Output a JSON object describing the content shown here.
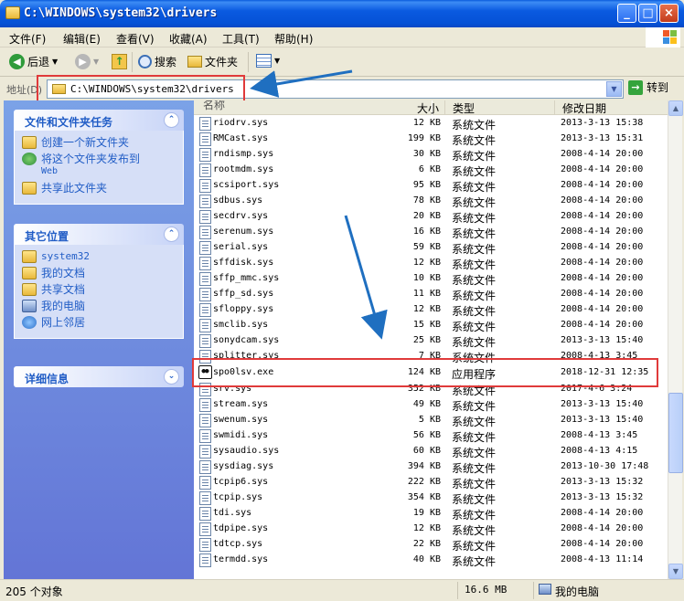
{
  "window": {
    "title": "C:\\WINDOWS\\system32\\drivers",
    "minimize": "_",
    "maximize": "□",
    "close": "×"
  },
  "menu": [
    "文件(F)",
    "编辑(E)",
    "查看(V)",
    "收藏(A)",
    "工具(T)",
    "帮助(H)"
  ],
  "toolbar": {
    "back": "后退",
    "search": "搜索",
    "folders": "文件夹"
  },
  "address": {
    "label": "地址(D)",
    "value": "C:\\WINDOWS\\system32\\drivers",
    "go": "转到"
  },
  "left_pane": {
    "tasks": {
      "title": "文件和文件夹任务",
      "items": [
        "创建一个新文件夹",
        "将这个文件夹发布到",
        "共享此文件夹"
      ],
      "sub": "Web"
    },
    "other_places": {
      "title": "其它位置",
      "items": [
        "system32",
        "我的文档",
        "共享文档",
        "我的电脑",
        "网上邻居"
      ]
    },
    "details": {
      "title": "详细信息"
    }
  },
  "columns": {
    "name": "名称",
    "size": "大小",
    "type": "类型",
    "date": "修改日期"
  },
  "files": [
    {
      "name": "riodrv.sys",
      "size": "12 KB",
      "type": "系统文件",
      "date": "2013-3-13 15:38"
    },
    {
      "name": "RMCast.sys",
      "size": "199 KB",
      "type": "系统文件",
      "date": "2013-3-13 15:31"
    },
    {
      "name": "rndismp.sys",
      "size": "30 KB",
      "type": "系统文件",
      "date": "2008-4-14 20:00"
    },
    {
      "name": "rootmdm.sys",
      "size": "6 KB",
      "type": "系统文件",
      "date": "2008-4-14 20:00"
    },
    {
      "name": "scsiport.sys",
      "size": "95 KB",
      "type": "系统文件",
      "date": "2008-4-14 20:00"
    },
    {
      "name": "sdbus.sys",
      "size": "78 KB",
      "type": "系统文件",
      "date": "2008-4-14 20:00"
    },
    {
      "name": "secdrv.sys",
      "size": "20 KB",
      "type": "系统文件",
      "date": "2008-4-14 20:00"
    },
    {
      "name": "serenum.sys",
      "size": "16 KB",
      "type": "系统文件",
      "date": "2008-4-14 20:00"
    },
    {
      "name": "serial.sys",
      "size": "59 KB",
      "type": "系统文件",
      "date": "2008-4-14 20:00"
    },
    {
      "name": "sffdisk.sys",
      "size": "12 KB",
      "type": "系统文件",
      "date": "2008-4-14 20:00"
    },
    {
      "name": "sffp_mmc.sys",
      "size": "10 KB",
      "type": "系统文件",
      "date": "2008-4-14 20:00"
    },
    {
      "name": "sffp_sd.sys",
      "size": "11 KB",
      "type": "系统文件",
      "date": "2008-4-14 20:00"
    },
    {
      "name": "sfloppy.sys",
      "size": "12 KB",
      "type": "系统文件",
      "date": "2008-4-14 20:00"
    },
    {
      "name": "smclib.sys",
      "size": "15 KB",
      "type": "系统文件",
      "date": "2008-4-14 20:00"
    },
    {
      "name": "sonydcam.sys",
      "size": "25 KB",
      "type": "系统文件",
      "date": "2013-3-13 15:40"
    },
    {
      "name": "splitter.sys",
      "size": "7 KB",
      "type": "系统文件",
      "date": "2008-4-13 3:45"
    },
    {
      "name": "spo0lsv.exe",
      "size": "124 KB",
      "type": "应用程序",
      "date": "2018-12-31 12:35",
      "exe": true
    },
    {
      "name": "srv.sys",
      "size": "352 KB",
      "type": "系统文件",
      "date": "2017-4-6 3:24"
    },
    {
      "name": "stream.sys",
      "size": "49 KB",
      "type": "系统文件",
      "date": "2013-3-13 15:40"
    },
    {
      "name": "swenum.sys",
      "size": "5 KB",
      "type": "系统文件",
      "date": "2013-3-13 15:40"
    },
    {
      "name": "swmidi.sys",
      "size": "56 KB",
      "type": "系统文件",
      "date": "2008-4-13 3:45"
    },
    {
      "name": "sysaudio.sys",
      "size": "60 KB",
      "type": "系统文件",
      "date": "2008-4-13 4:15"
    },
    {
      "name": "sysdiag.sys",
      "size": "394 KB",
      "type": "系统文件",
      "date": "2013-10-30 17:48"
    },
    {
      "name": "tcpip6.sys",
      "size": "222 KB",
      "type": "系统文件",
      "date": "2013-3-13 15:32"
    },
    {
      "name": "tcpip.sys",
      "size": "354 KB",
      "type": "系统文件",
      "date": "2013-3-13 15:32"
    },
    {
      "name": "tdi.sys",
      "size": "19 KB",
      "type": "系统文件",
      "date": "2008-4-14 20:00"
    },
    {
      "name": "tdpipe.sys",
      "size": "12 KB",
      "type": "系统文件",
      "date": "2008-4-14 20:00"
    },
    {
      "name": "tdtcp.sys",
      "size": "22 KB",
      "type": "系统文件",
      "date": "2008-4-14 20:00"
    },
    {
      "name": "termdd.sys",
      "size": "40 KB",
      "type": "系统文件",
      "date": "2008-4-13 11:14"
    }
  ],
  "status": {
    "count": "205 个对象",
    "size": "16.6 MB",
    "location": "我的电脑"
  },
  "colors": {
    "title_blue": "#0a5ae0",
    "pane_blue": "#6f8fdf",
    "link_blue": "#215dc6",
    "highlight_red": "#e03a3a",
    "arrow_blue": "#1f6fc0"
  }
}
